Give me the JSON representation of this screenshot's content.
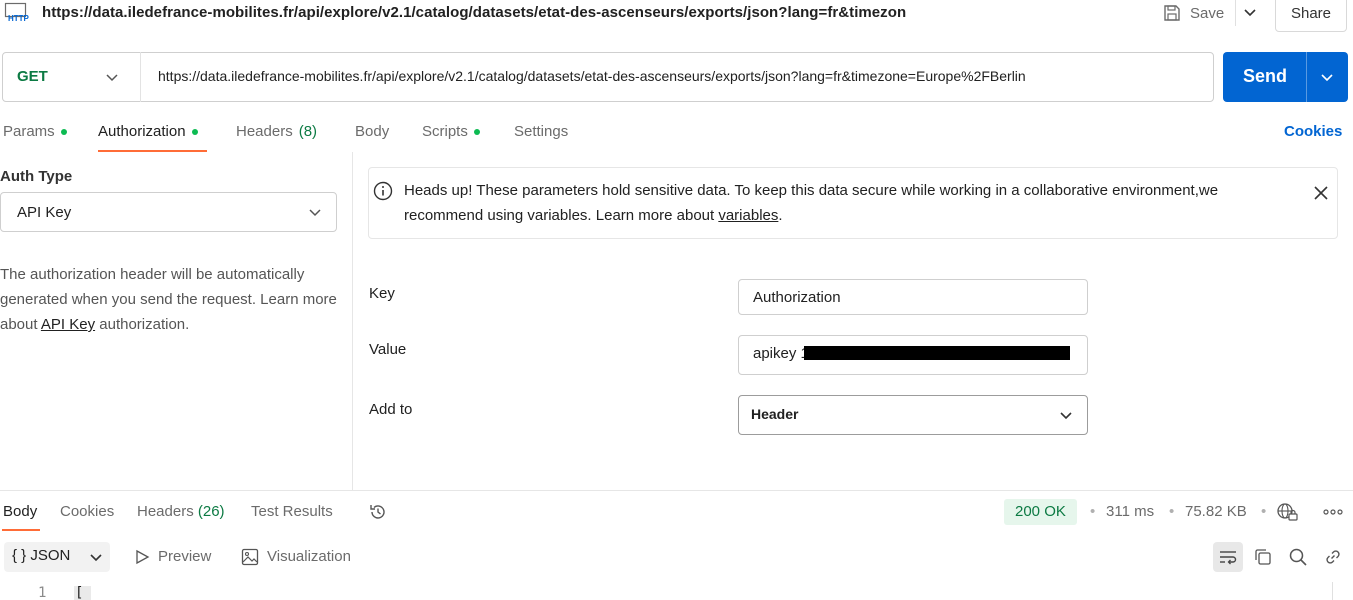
{
  "header": {
    "title": "https://data.iledefrance-mobilites.fr/api/explore/v2.1/catalog/datasets/etat-des-ascenseurs/exports/json?lang=fr&timezon",
    "http_icon_text": "HTTP",
    "save_label": "Save",
    "share_label": "Share"
  },
  "request": {
    "method": "GET",
    "url": "https://data.iledefrance-mobilites.fr/api/explore/v2.1/catalog/datasets/etat-des-ascenseurs/exports/json?lang=fr&timezone=Europe%2FBerlin",
    "send_label": "Send"
  },
  "request_tabs": {
    "params": "Params",
    "authorization": "Authorization",
    "headers": "Headers",
    "headers_count": "(8)",
    "body": "Body",
    "scripts": "Scripts",
    "settings": "Settings",
    "cookies": "Cookies"
  },
  "auth": {
    "type_label": "Auth Type",
    "type_value": "API Key",
    "description_pre": "The authorization header will be automatically generated when you send the request. Learn more about ",
    "description_link": "API Key",
    "description_post": " authorization."
  },
  "notice": {
    "text_pre": "Heads up! These parameters hold sensitive data. To keep this data secure while working in a collaborative environment,we recommend using variables. Learn more about ",
    "link": "variables",
    "text_post": "."
  },
  "fields": {
    "key_label": "Key",
    "key_value": "Authorization",
    "value_label": "Value",
    "value_value": "apikey 1",
    "addto_label": "Add to",
    "addto_value": "Header"
  },
  "response": {
    "tabs": {
      "body": "Body",
      "cookies": "Cookies",
      "headers": "Headers",
      "headers_count": "(26)",
      "test_results": "Test Results"
    },
    "status": "200 OK",
    "time": "311 ms",
    "size": "75.82 KB",
    "format": "JSON",
    "format_icon": "{ }",
    "preview": "Preview",
    "visualization": "Visualization",
    "line_number": "1",
    "first_char": "["
  },
  "colors": {
    "accent": "#ff6c37",
    "send": "#0265d2",
    "method": "#0c7a43",
    "dot": "#0cbb52"
  }
}
